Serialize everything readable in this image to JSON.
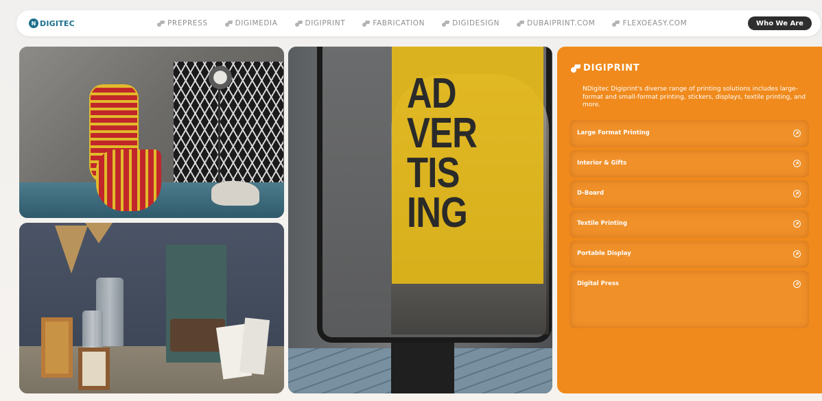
{
  "brand": {
    "mark": "N",
    "name": "DIGITEC"
  },
  "nav": {
    "links": [
      {
        "label": "PREPRESS"
      },
      {
        "label": "DIGIMEDIA"
      },
      {
        "label": "DIGIPRINT"
      },
      {
        "label": "FABRICATION"
      },
      {
        "label": "DIGIDESIGN"
      },
      {
        "label": "DUBAIPRINT.COM"
      },
      {
        "label": "FLEXOEASY.COM"
      }
    ],
    "cta_label": "Who We Are"
  },
  "hero": {
    "poster_text": "AD\nVER\nTIS\nING"
  },
  "card": {
    "title": "DIGIPRINT",
    "description": "NDigitec Digiprint's diverse range of printing solutions includes large-format and small-format printing, stickers, displays, textile printing, and more.",
    "items": [
      {
        "label": "Large Format Printing"
      },
      {
        "label": "Interior & Gifts"
      },
      {
        "label": "D-Board"
      },
      {
        "label": "Textile Printing"
      },
      {
        "label": "Portable Display"
      },
      {
        "label": "Digital Press"
      }
    ],
    "accent_color": "#f08a1c"
  }
}
